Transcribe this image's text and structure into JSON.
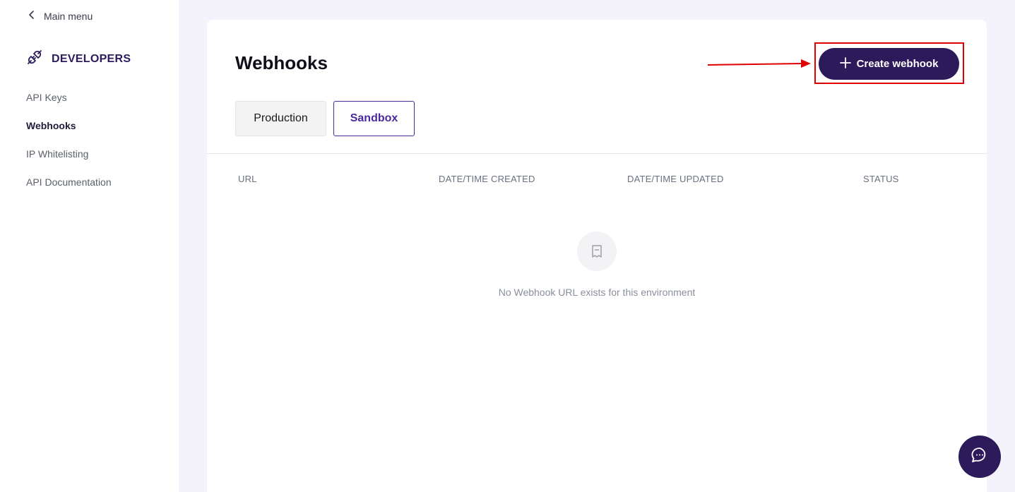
{
  "sidebar": {
    "back_label": "Main menu",
    "section_title": "DEVELOPERS",
    "items": [
      {
        "label": "API Keys",
        "active": false
      },
      {
        "label": "Webhooks",
        "active": true
      },
      {
        "label": "IP Whitelisting",
        "active": false
      },
      {
        "label": "API Documentation",
        "active": false
      }
    ]
  },
  "main": {
    "title": "Webhooks",
    "create_button_label": "Create webhook",
    "tabs": [
      {
        "label": "Production",
        "selected": false
      },
      {
        "label": "Sandbox",
        "selected": true
      }
    ],
    "table_headers": [
      "URL",
      "DATE/TIME CREATED",
      "DATE/TIME UPDATED",
      "STATUS"
    ],
    "empty_message": "No Webhook URL exists for this environment"
  },
  "icons": {
    "back": "chevron-left-icon",
    "section": "plug-icon",
    "create": "plus-icon",
    "empty": "receipt-icon",
    "chat": "chat-bubble-icon"
  },
  "colors": {
    "brand": "#2c1a5a",
    "accent": "#4b2a9e",
    "highlight": "#e00000"
  }
}
